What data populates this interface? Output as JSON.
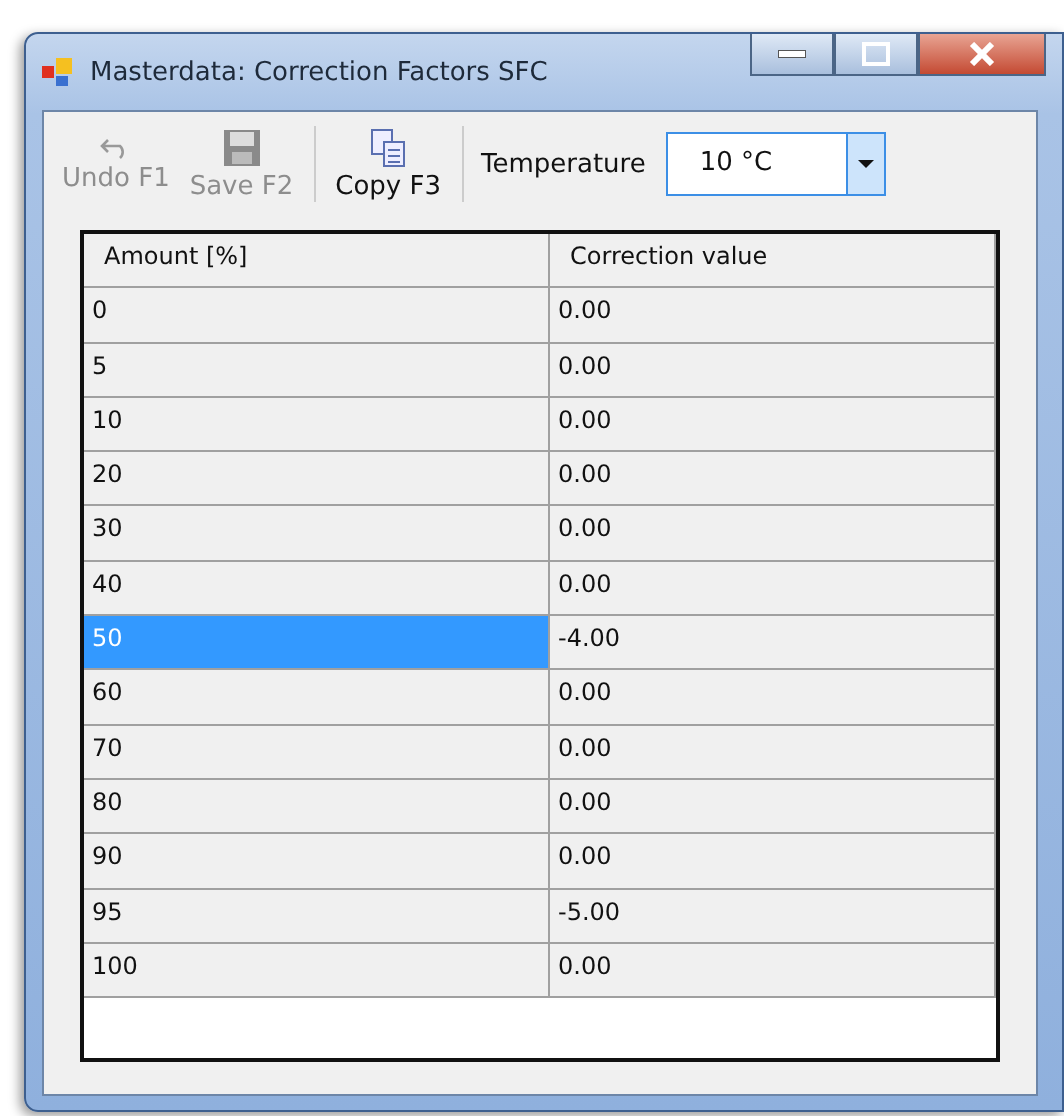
{
  "window": {
    "title": "Masterdata: Correction Factors SFC"
  },
  "toolbar": {
    "buttons": [
      {
        "kind": "undo",
        "label": "Undo F1",
        "disabled": true
      },
      {
        "kind": "save",
        "label": "Save F2",
        "disabled": true
      },
      {
        "kind": "copy",
        "label": "Copy F3",
        "disabled": false
      }
    ],
    "temperature": {
      "label": "Temperature",
      "value": "10 °C"
    }
  },
  "table": {
    "columns": [
      "Amount [%]",
      "Correction value"
    ],
    "rows": [
      {
        "amount": "0",
        "value": "0.00",
        "selected": false
      },
      {
        "amount": "5",
        "value": "0.00",
        "selected": false
      },
      {
        "amount": "10",
        "value": "0.00",
        "selected": false
      },
      {
        "amount": "20",
        "value": "0.00",
        "selected": false
      },
      {
        "amount": "30",
        "value": "0.00",
        "selected": false
      },
      {
        "amount": "40",
        "value": "0.00",
        "selected": false
      },
      {
        "amount": "50",
        "value": "-4.00",
        "selected": true
      },
      {
        "amount": "60",
        "value": "0.00",
        "selected": false
      },
      {
        "amount": "70",
        "value": "0.00",
        "selected": false
      },
      {
        "amount": "80",
        "value": "0.00",
        "selected": false
      },
      {
        "amount": "90",
        "value": "0.00",
        "selected": false
      },
      {
        "amount": "95",
        "value": "-5.00",
        "selected": false
      },
      {
        "amount": "100",
        "value": "0.00",
        "selected": false
      }
    ]
  }
}
